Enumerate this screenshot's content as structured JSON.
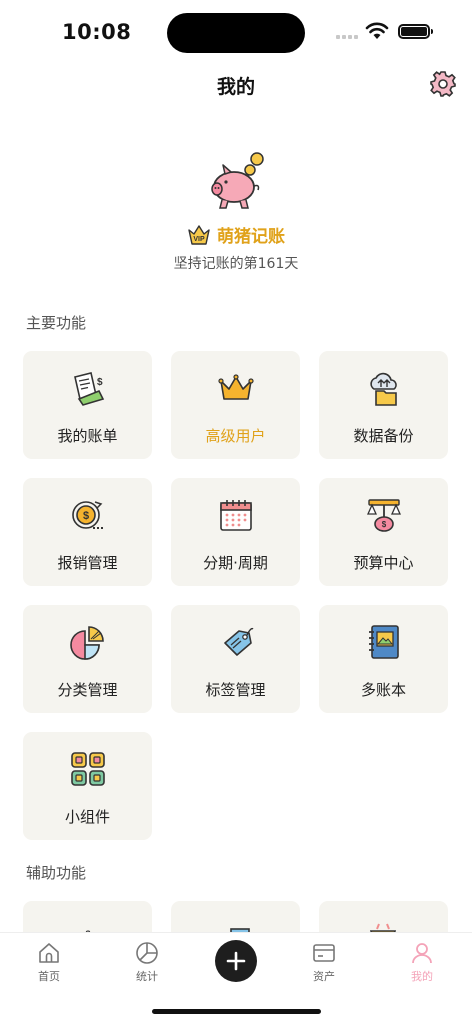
{
  "status_bar": {
    "time": "10:08"
  },
  "header": {
    "title": "我的",
    "settings_icon": "gear-icon"
  },
  "profile": {
    "logo_icon": "piggy-bank-icon",
    "badge_icon": "vip-crown-icon",
    "app_name": "萌猪记账",
    "days_text": "坚持记账的第161天"
  },
  "main_section": {
    "title": "主要功能",
    "items": [
      {
        "label": "我的账单",
        "icon": "receipt-icon"
      },
      {
        "label": "高级用户",
        "icon": "crown-icon",
        "highlight": true
      },
      {
        "label": "数据备份",
        "icon": "cloud-folder-icon"
      },
      {
        "label": "报销管理",
        "icon": "coin-refund-icon"
      },
      {
        "label": "分期·周期",
        "icon": "calendar-icon"
      },
      {
        "label": "预算中心",
        "icon": "scale-piggy-icon"
      },
      {
        "label": "分类管理",
        "icon": "pie-chart-icon"
      },
      {
        "label": "标签管理",
        "icon": "tag-icon"
      },
      {
        "label": "多账本",
        "icon": "notebook-icon"
      },
      {
        "label": "小组件",
        "icon": "widgets-icon"
      }
    ]
  },
  "aux_section": {
    "title": "辅助功能"
  },
  "tab_bar": {
    "tabs": [
      {
        "label": "首页",
        "icon": "home-icon"
      },
      {
        "label": "统计",
        "icon": "chart-icon"
      },
      {
        "label": "",
        "icon": "plus-icon"
      },
      {
        "label": "资产",
        "icon": "card-icon"
      },
      {
        "label": "我的",
        "icon": "user-icon",
        "active": true
      }
    ]
  },
  "colors": {
    "accent_gold": "#e0a21a",
    "active_pink": "#f4a3b8",
    "tile_bg": "#f5f4ef"
  }
}
